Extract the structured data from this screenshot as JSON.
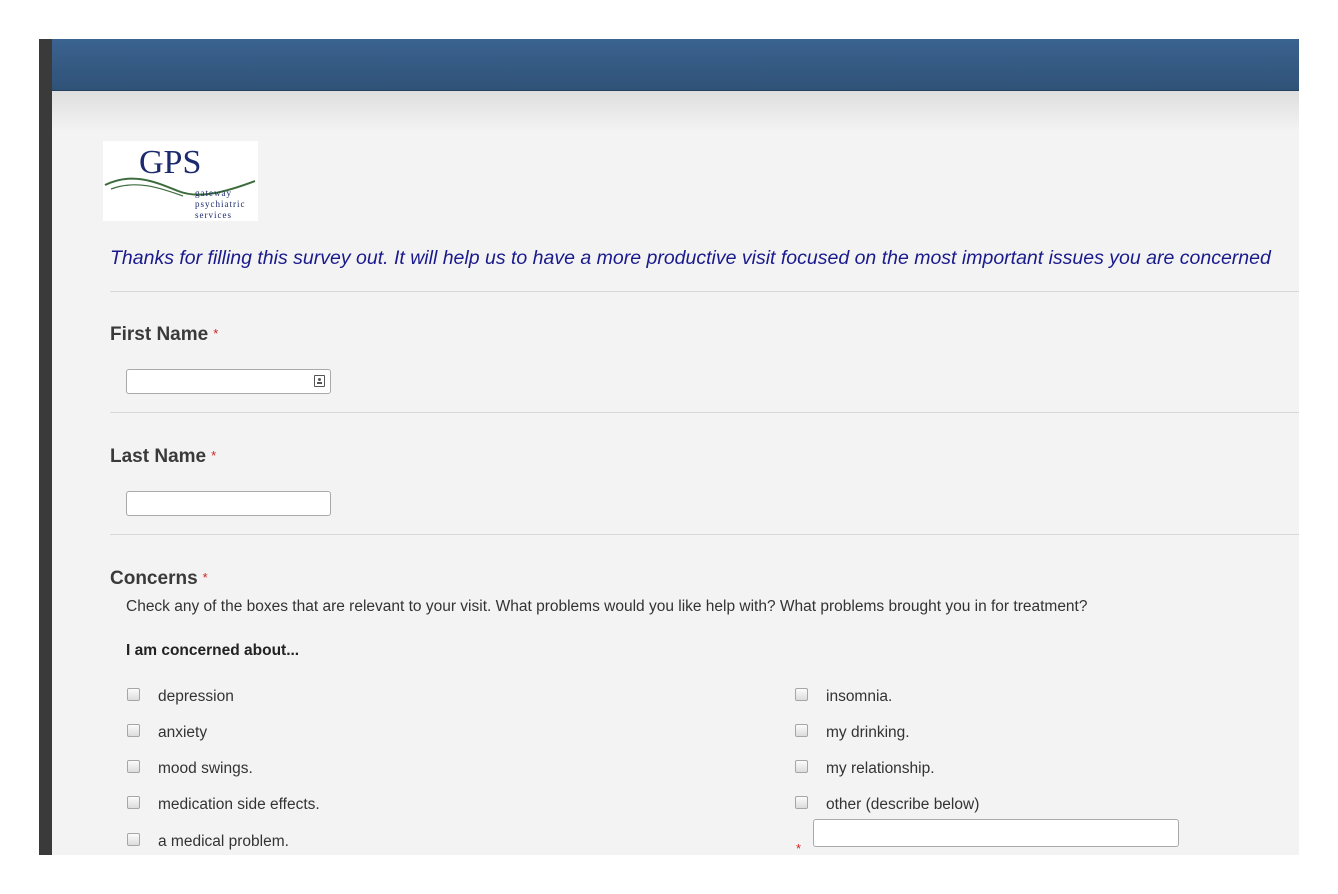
{
  "logo": {
    "letters": "GPS",
    "lines": [
      "gateway",
      "psychiatric",
      "services"
    ]
  },
  "intro": "Thanks for filling this survey out. It will help us to have a more productive visit focused on the most important issues you are concerned",
  "fields": {
    "first_name": {
      "label": "First Name",
      "required_mark": "*",
      "value": ""
    },
    "last_name": {
      "label": "Last Name",
      "required_mark": "*",
      "value": ""
    }
  },
  "concerns": {
    "label": "Concerns",
    "required_mark": "*",
    "help": "Check any of the boxes that are relevant to your visit. What problems would you like help with? What problems brought you in for treatment?",
    "subheading": "I am concerned about...",
    "options_left": [
      "depression",
      "anxiety",
      "mood swings.",
      "medication side effects.",
      "a medical problem."
    ],
    "options_right": [
      "insomnia.",
      "my drinking.",
      "my relationship.",
      "other (describe below)"
    ],
    "other_required_mark": "*"
  },
  "colors": {
    "header_bar": "#34597f",
    "intro_text": "#1a1a8c",
    "required": "#d12020",
    "logo_navy": "#1c2a6e",
    "logo_green": "#3c6b3c"
  }
}
